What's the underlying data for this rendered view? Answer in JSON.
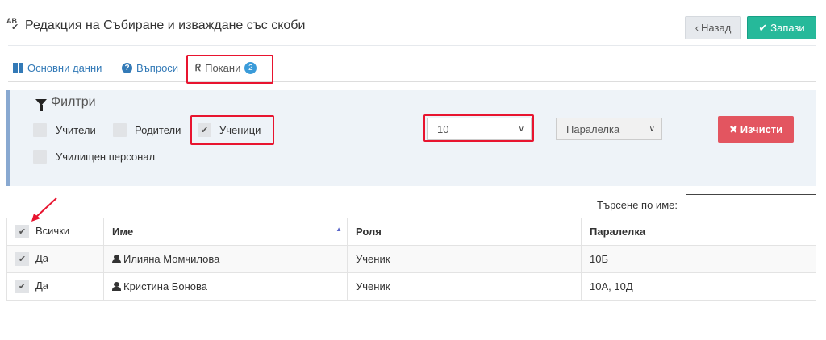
{
  "header": {
    "title_icon_letters": "AB",
    "title": "Редакция на Събиране и изваждане със скоби",
    "back_label": "Назад",
    "save_label": "Запази"
  },
  "tabs": [
    {
      "label": "Основни данни",
      "icon": "grid-icon"
    },
    {
      "label": "Въпроси",
      "icon": "question-circle-icon"
    },
    {
      "label": "Покани",
      "icon": "rss-icon",
      "badge": "2"
    }
  ],
  "filters": {
    "title": "Филтри",
    "checkboxes": [
      {
        "label": "Учители",
        "checked": false
      },
      {
        "label": "Родители",
        "checked": false
      },
      {
        "label": "Ученици",
        "checked": true
      },
      {
        "label": "Училищен персонал",
        "checked": false
      }
    ],
    "grade_select": "10",
    "class_select": "Паралелка",
    "clear_label": "Изчисти"
  },
  "search": {
    "label": "Търсене по име:",
    "value": ""
  },
  "table": {
    "headers": [
      "Всички",
      "Име",
      "Роля",
      "Паралелка"
    ],
    "rows": [
      {
        "selected": "Да",
        "name": "Илияна Момчилова",
        "role": "Ученик",
        "class": "10Б"
      },
      {
        "selected": "Да",
        "name": "Кристина Бонова",
        "role": "Ученик",
        "class": "10А, 10Д"
      }
    ]
  },
  "colors": {
    "accent_green": "#26b99a",
    "highlight_red": "#e8142f",
    "clear_button": "#e35560",
    "link_blue": "#337ab7"
  }
}
